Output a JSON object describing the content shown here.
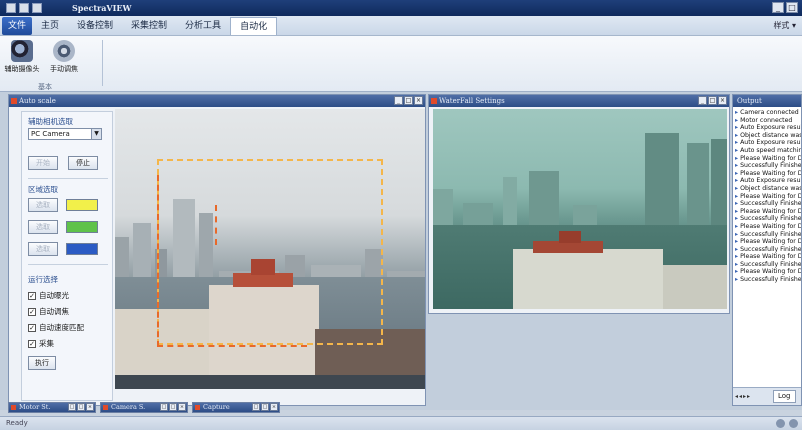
{
  "app": {
    "title": "SpectraVIEW"
  },
  "menu": {
    "file": "文件",
    "tabs": [
      "主页",
      "设备控制",
      "采集控制",
      "分析工具",
      "自动化"
    ],
    "active_index": 4,
    "right_label": "样式 ▾"
  },
  "ribbon": {
    "buttons": [
      {
        "label": "辅助摄像头",
        "icon": "camera-icon"
      },
      {
        "label": "手动调焦",
        "icon": "motor-icon"
      }
    ],
    "group_label": "基本"
  },
  "auto_scale": {
    "title": "Auto scale",
    "camera_section": "辅助相机选取",
    "camera_select": "PC Camera",
    "start_btn": "开始",
    "stop_btn": "停止",
    "region_section": "区域选取",
    "region_buttons": [
      "选取",
      "选取",
      "选取"
    ],
    "region_colors": [
      "#f2f04a",
      "#5fc24a",
      "#2b5bc4"
    ],
    "run_section": "运行选择",
    "options": [
      "自动曝光",
      "自动调焦",
      "自动速度匹配",
      "采集"
    ],
    "execute_btn": "执行"
  },
  "waterfall": {
    "title": "WaterFall Settings"
  },
  "output": {
    "title": "Output",
    "log": [
      "Camera connected",
      "Motor connected",
      "Auto Exposure result",
      "Object distance was",
      "Auto Exposure result",
      "Auto speed matchin",
      "Please Waiting for D",
      "Successfully Finishe",
      "Please Waiting for D",
      "Auto Exposure result",
      "Object distance was",
      "Please Waiting for D",
      "Successfully Finishe",
      "Please Waiting for D",
      "Successfully Finishe",
      "Please Waiting for D",
      "Successfully Finishe",
      "Please Waiting for D",
      "Successfully Finishe",
      "Please Waiting for D",
      "Successfully Finishe",
      "Please Waiting for D",
      "Successfully Finishe"
    ],
    "tab": "Log"
  },
  "minimized": [
    "Motor St.",
    "Camera S.",
    "Capture"
  ],
  "status": {
    "text": "Ready"
  }
}
